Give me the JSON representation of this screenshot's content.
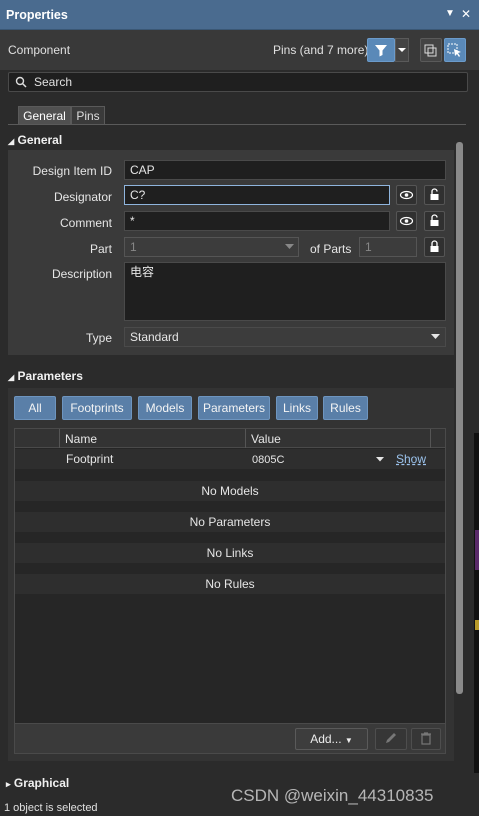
{
  "titlebar": {
    "title": "Properties"
  },
  "component_row": {
    "label": "Component",
    "filter_summary": "Pins (and 7 more)"
  },
  "search": {
    "placeholder": "Search"
  },
  "tabs": [
    {
      "label": "General"
    },
    {
      "label": "Pins"
    }
  ],
  "general": {
    "heading": "General",
    "design_item_id": {
      "label": "Design Item ID",
      "value": "CAP"
    },
    "designator": {
      "label": "Designator",
      "value": "C?"
    },
    "comment": {
      "label": "Comment",
      "value": "*"
    },
    "part": {
      "label": "Part",
      "value": "1",
      "of_parts_label": "of Parts",
      "of_parts_value": "1"
    },
    "description": {
      "label": "Description",
      "value": "电容"
    },
    "type": {
      "label": "Type",
      "value": "Standard"
    }
  },
  "parameters": {
    "heading": "Parameters",
    "filters": [
      "All",
      "Footprints",
      "Models",
      "Parameters",
      "Links",
      "Rules"
    ],
    "columns": [
      "Name",
      "Value"
    ],
    "rows": [
      {
        "name": "Footprint",
        "value": "0805C",
        "action": "Show"
      }
    ],
    "empty_messages": [
      "No Models",
      "No Parameters",
      "No Links",
      "No Rules"
    ],
    "add_label": "Add..."
  },
  "graphical": {
    "heading": "Graphical"
  },
  "status": {
    "text": "1 object is selected"
  },
  "watermark": "CSDN @weixin_44310835"
}
